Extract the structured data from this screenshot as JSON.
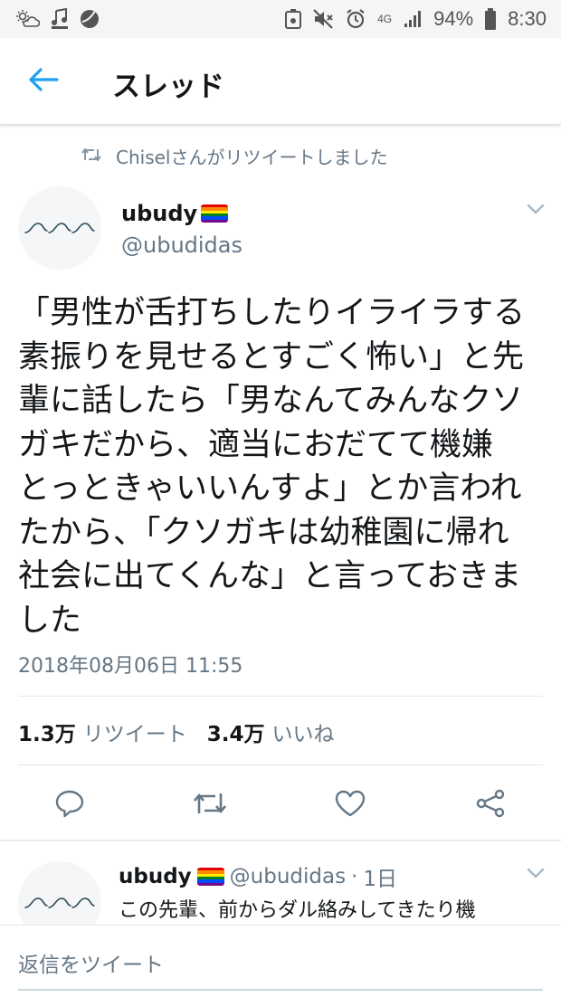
{
  "status_bar": {
    "left_icons": [
      "weather-cloud-icon",
      "music-note-icon",
      "app-ball-icon"
    ],
    "right_icons": [
      "screenshot-icon",
      "mute-icon",
      "alarm-icon",
      "network-4g-icon",
      "signal-icon",
      "battery-icon"
    ],
    "network": "4G",
    "battery": "94%",
    "time": "8:30"
  },
  "header": {
    "title": "スレッド",
    "back_icon": "back-arrow-icon"
  },
  "retweet_context": {
    "text": "Chiselさんがリツイートしました",
    "icon": "retweet-icon"
  },
  "tweet": {
    "author_name": "ubudy",
    "author_handle": "@ubudidas",
    "badge": "rainbow-flag",
    "text": "「男性が舌打ちしたりイライラする\n素振りを見せるとすごく怖い」と先\n輩に話したら「男なんてみんなクソ\nガキだから、適当におだてて機嫌\nとっときゃいいんすよ」とか言われ\nたから、「クソガキは幼稚園に帰れ\n社会に出てくんな」と言っておきま\nした",
    "timestamp": "2018年08月06日 11:55",
    "retweets_count": "1.3万",
    "retweets_label": "リツイート",
    "likes_count": "3.4万",
    "likes_label": "いいね",
    "actions": [
      "reply-icon",
      "retweet-icon",
      "like-heart-icon",
      "share-icon"
    ]
  },
  "reply": {
    "author_name": "ubudy",
    "author_handle": "@ubudidas",
    "separator": "·",
    "age": "1日",
    "text": "この先輩、前からダル絡みしてきたり機"
  },
  "composer": {
    "placeholder": "返信をツイート"
  },
  "colors": {
    "accent": "#1da1f2",
    "text_primary": "#14171a",
    "text_secondary": "#657786",
    "divider": "#e1e8ed",
    "rainbow": [
      "#e40303",
      "#ff8c00",
      "#ffed00",
      "#008026",
      "#004dff",
      "#750787"
    ]
  }
}
